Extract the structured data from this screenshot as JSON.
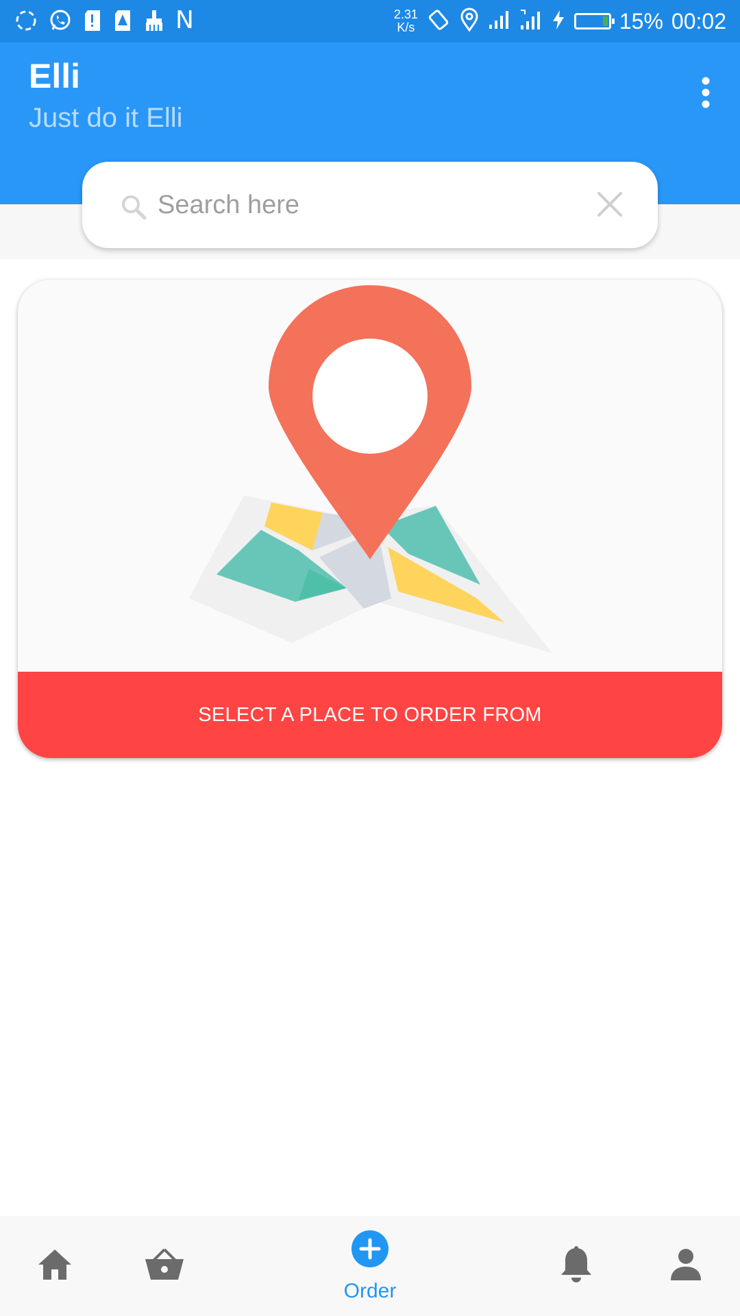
{
  "status_bar": {
    "net_speed_value": "2.31",
    "net_speed_unit": "K/s",
    "battery_percent": "15%",
    "time": "00:02",
    "left_letter": "N",
    "battery_level": 0.15
  },
  "header": {
    "title": "Elli",
    "subtitle": "Just do it Elli",
    "menu_icon": "more-vert-icon"
  },
  "search": {
    "placeholder": "Search here",
    "value": ""
  },
  "card": {
    "illustration": "map-location-pin",
    "button_label": "SELECT A PLACE TO ORDER FROM"
  },
  "bottom_nav": {
    "items": [
      {
        "icon": "home-icon",
        "label": ""
      },
      {
        "icon": "basket-icon",
        "label": ""
      },
      {
        "icon": "add-circle-icon",
        "label": "Order"
      },
      {
        "icon": "bell-icon",
        "label": ""
      },
      {
        "icon": "person-icon",
        "label": ""
      }
    ],
    "active": "Order"
  },
  "colors": {
    "status_bar": "#1e88e5",
    "app_bar": "#2997f8",
    "subtitle": "#b8dcff",
    "action_button": "#ff4444",
    "pin": "#f4715a",
    "nav_active": "#2196f3",
    "nav_inactive": "#6b6b6b"
  }
}
